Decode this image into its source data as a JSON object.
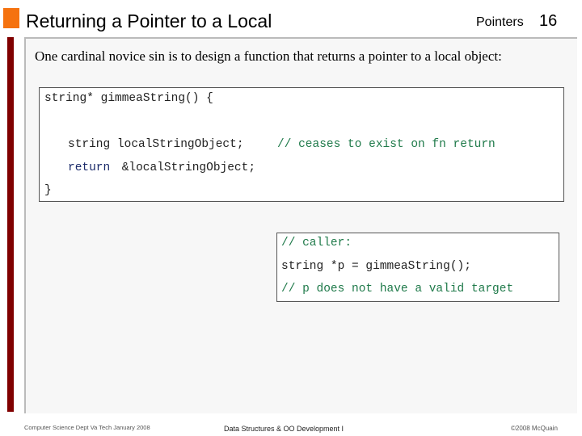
{
  "header": {
    "title": "Returning a Pointer to a Local",
    "section": "Pointers",
    "page": "16"
  },
  "intro": "One cardinal novice sin is to design a function that returns a pointer to a local object:",
  "code1": {
    "l1": "string* gimmeaString() {",
    "l2_code": "string localStringObject;",
    "l2_comment": "// ceases to exist on fn return",
    "l3_kw": "return",
    "l3_rest": " &localStringObject;",
    "l4": "}"
  },
  "code2": {
    "l1": "// caller:",
    "l2": "string *p = gimmeaString();",
    "l3": "// p does not have a valid target"
  },
  "footer": {
    "left": "Computer Science Dept Va Tech January 2008",
    "center": "Data Structures & OO Development I",
    "right": "©2008  McQuain"
  },
  "colors": {
    "accent": "#f5720f",
    "sidebar": "#800000",
    "comment": "#1f7a4a"
  }
}
